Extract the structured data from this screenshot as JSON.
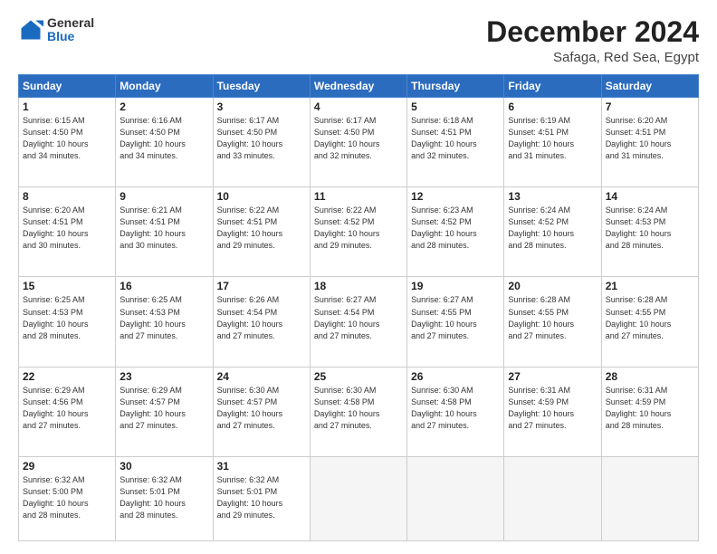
{
  "header": {
    "logo_general": "General",
    "logo_blue": "Blue",
    "month_title": "December 2024",
    "location": "Safaga, Red Sea, Egypt"
  },
  "days_of_week": [
    "Sunday",
    "Monday",
    "Tuesday",
    "Wednesday",
    "Thursday",
    "Friday",
    "Saturday"
  ],
  "weeks": [
    [
      {
        "day": "1",
        "detail": "Sunrise: 6:15 AM\nSunset: 4:50 PM\nDaylight: 10 hours\nand 34 minutes."
      },
      {
        "day": "2",
        "detail": "Sunrise: 6:16 AM\nSunset: 4:50 PM\nDaylight: 10 hours\nand 34 minutes."
      },
      {
        "day": "3",
        "detail": "Sunrise: 6:17 AM\nSunset: 4:50 PM\nDaylight: 10 hours\nand 33 minutes."
      },
      {
        "day": "4",
        "detail": "Sunrise: 6:17 AM\nSunset: 4:50 PM\nDaylight: 10 hours\nand 32 minutes."
      },
      {
        "day": "5",
        "detail": "Sunrise: 6:18 AM\nSunset: 4:51 PM\nDaylight: 10 hours\nand 32 minutes."
      },
      {
        "day": "6",
        "detail": "Sunrise: 6:19 AM\nSunset: 4:51 PM\nDaylight: 10 hours\nand 31 minutes."
      },
      {
        "day": "7",
        "detail": "Sunrise: 6:20 AM\nSunset: 4:51 PM\nDaylight: 10 hours\nand 31 minutes."
      }
    ],
    [
      {
        "day": "8",
        "detail": "Sunrise: 6:20 AM\nSunset: 4:51 PM\nDaylight: 10 hours\nand 30 minutes."
      },
      {
        "day": "9",
        "detail": "Sunrise: 6:21 AM\nSunset: 4:51 PM\nDaylight: 10 hours\nand 30 minutes."
      },
      {
        "day": "10",
        "detail": "Sunrise: 6:22 AM\nSunset: 4:51 PM\nDaylight: 10 hours\nand 29 minutes."
      },
      {
        "day": "11",
        "detail": "Sunrise: 6:22 AM\nSunset: 4:52 PM\nDaylight: 10 hours\nand 29 minutes."
      },
      {
        "day": "12",
        "detail": "Sunrise: 6:23 AM\nSunset: 4:52 PM\nDaylight: 10 hours\nand 28 minutes."
      },
      {
        "day": "13",
        "detail": "Sunrise: 6:24 AM\nSunset: 4:52 PM\nDaylight: 10 hours\nand 28 minutes."
      },
      {
        "day": "14",
        "detail": "Sunrise: 6:24 AM\nSunset: 4:53 PM\nDaylight: 10 hours\nand 28 minutes."
      }
    ],
    [
      {
        "day": "15",
        "detail": "Sunrise: 6:25 AM\nSunset: 4:53 PM\nDaylight: 10 hours\nand 28 minutes."
      },
      {
        "day": "16",
        "detail": "Sunrise: 6:25 AM\nSunset: 4:53 PM\nDaylight: 10 hours\nand 27 minutes."
      },
      {
        "day": "17",
        "detail": "Sunrise: 6:26 AM\nSunset: 4:54 PM\nDaylight: 10 hours\nand 27 minutes."
      },
      {
        "day": "18",
        "detail": "Sunrise: 6:27 AM\nSunset: 4:54 PM\nDaylight: 10 hours\nand 27 minutes."
      },
      {
        "day": "19",
        "detail": "Sunrise: 6:27 AM\nSunset: 4:55 PM\nDaylight: 10 hours\nand 27 minutes."
      },
      {
        "day": "20",
        "detail": "Sunrise: 6:28 AM\nSunset: 4:55 PM\nDaylight: 10 hours\nand 27 minutes."
      },
      {
        "day": "21",
        "detail": "Sunrise: 6:28 AM\nSunset: 4:55 PM\nDaylight: 10 hours\nand 27 minutes."
      }
    ],
    [
      {
        "day": "22",
        "detail": "Sunrise: 6:29 AM\nSunset: 4:56 PM\nDaylight: 10 hours\nand 27 minutes."
      },
      {
        "day": "23",
        "detail": "Sunrise: 6:29 AM\nSunset: 4:57 PM\nDaylight: 10 hours\nand 27 minutes."
      },
      {
        "day": "24",
        "detail": "Sunrise: 6:30 AM\nSunset: 4:57 PM\nDaylight: 10 hours\nand 27 minutes."
      },
      {
        "day": "25",
        "detail": "Sunrise: 6:30 AM\nSunset: 4:58 PM\nDaylight: 10 hours\nand 27 minutes."
      },
      {
        "day": "26",
        "detail": "Sunrise: 6:30 AM\nSunset: 4:58 PM\nDaylight: 10 hours\nand 27 minutes."
      },
      {
        "day": "27",
        "detail": "Sunrise: 6:31 AM\nSunset: 4:59 PM\nDaylight: 10 hours\nand 27 minutes."
      },
      {
        "day": "28",
        "detail": "Sunrise: 6:31 AM\nSunset: 4:59 PM\nDaylight: 10 hours\nand 28 minutes."
      }
    ],
    [
      {
        "day": "29",
        "detail": "Sunrise: 6:32 AM\nSunset: 5:00 PM\nDaylight: 10 hours\nand 28 minutes."
      },
      {
        "day": "30",
        "detail": "Sunrise: 6:32 AM\nSunset: 5:01 PM\nDaylight: 10 hours\nand 28 minutes."
      },
      {
        "day": "31",
        "detail": "Sunrise: 6:32 AM\nSunset: 5:01 PM\nDaylight: 10 hours\nand 29 minutes."
      },
      null,
      null,
      null,
      null
    ]
  ]
}
